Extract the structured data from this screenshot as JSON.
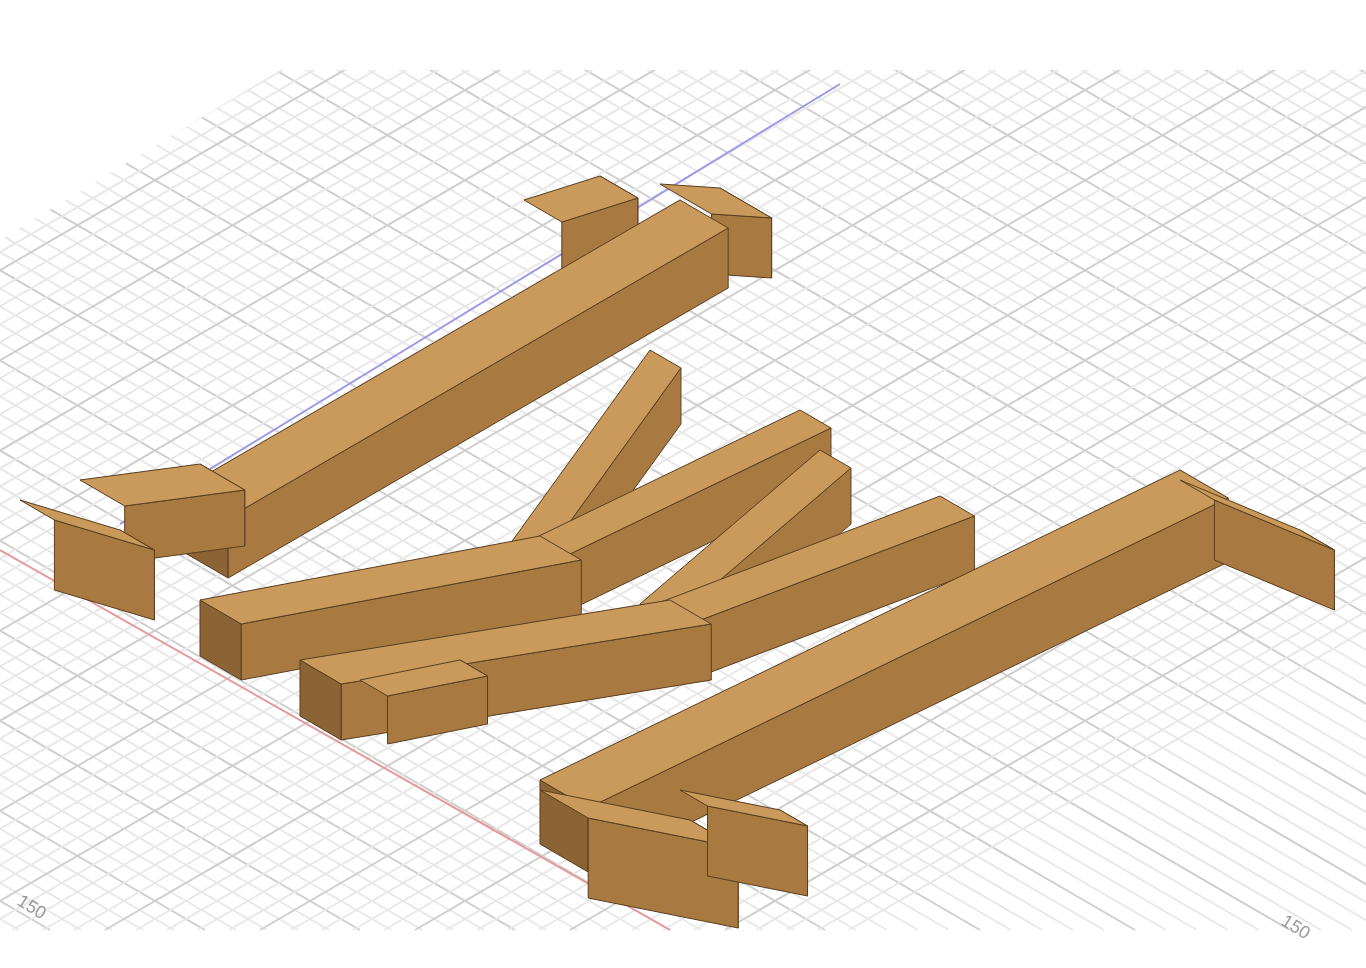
{
  "viewport": {
    "grid_labels": [
      {
        "text": "150"
      },
      {
        "text": "150"
      }
    ]
  }
}
